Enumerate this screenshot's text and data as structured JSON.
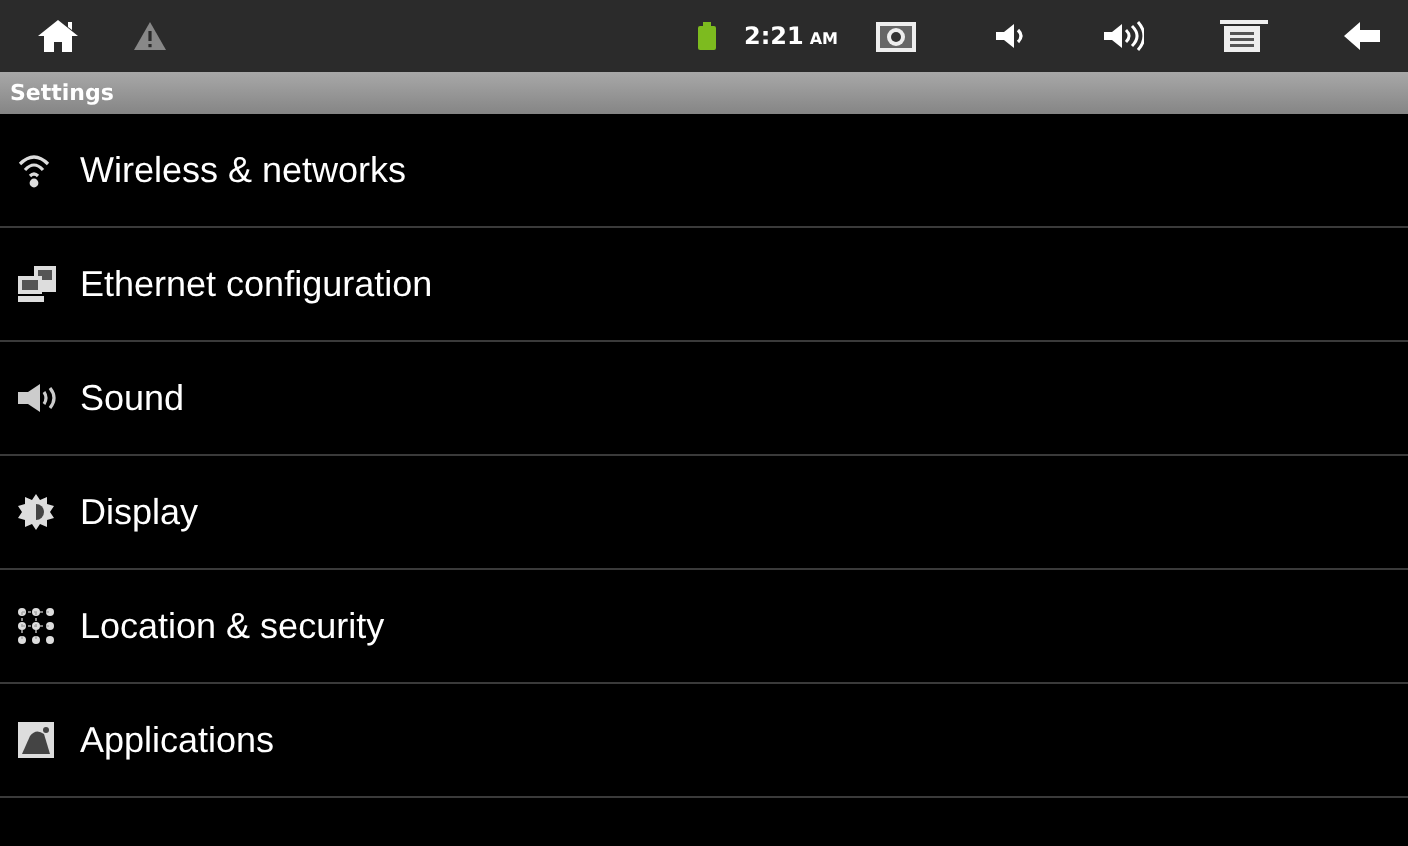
{
  "status_bar": {
    "time": "2:21",
    "meridiem": "AM"
  },
  "title_bar": {
    "title": "Settings"
  },
  "settings_list": [
    {
      "label": "Wireless & networks",
      "kind": "wireless"
    },
    {
      "label": "Ethernet configuration",
      "kind": "ethernet"
    },
    {
      "label": "Sound",
      "kind": "sound"
    },
    {
      "label": "Display",
      "kind": "display"
    },
    {
      "label": "Location & security",
      "kind": "location"
    },
    {
      "label": "Applications",
      "kind": "applications"
    }
  ]
}
